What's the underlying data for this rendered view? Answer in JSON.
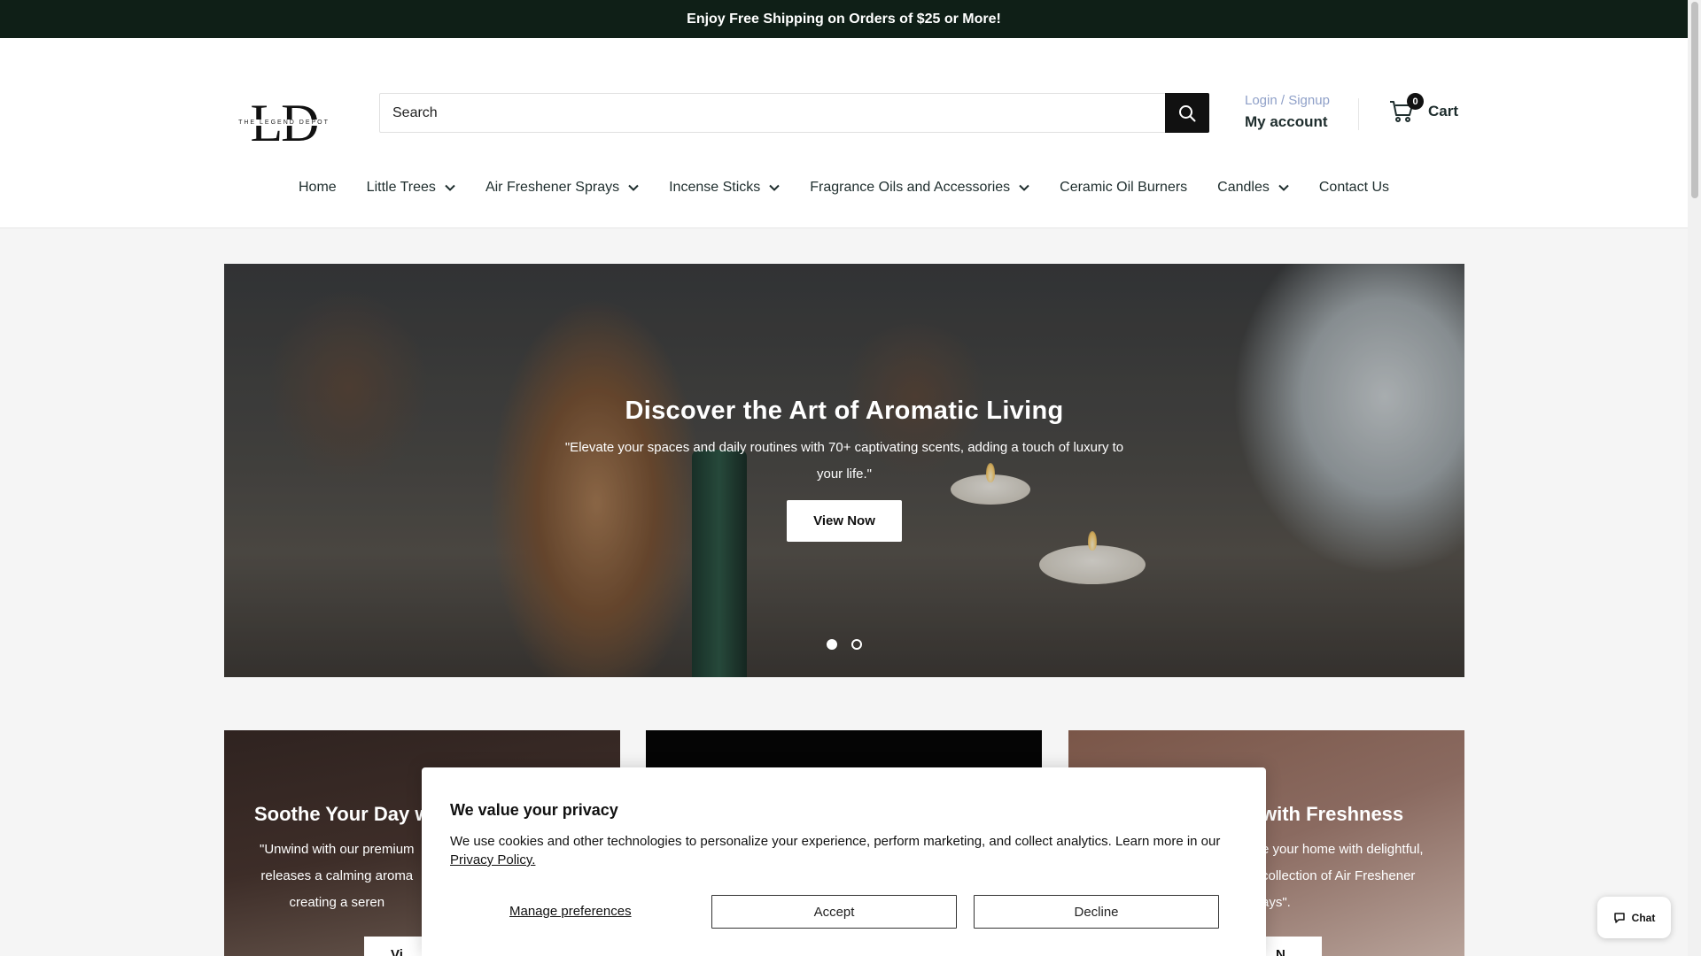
{
  "announcement": "Enjoy Free Shipping on Orders of $25 or More!",
  "header": {
    "logo_mark": "LD",
    "logo_text": "THE LEGEND DEPOT",
    "search_placeholder": "Search",
    "login_label": "Login / Signup",
    "account_label": "My account",
    "cart_count": "0",
    "cart_label": "Cart"
  },
  "nav": {
    "items": [
      {
        "label": "Home",
        "dropdown": false
      },
      {
        "label": "Little Trees",
        "dropdown": true
      },
      {
        "label": "Air Freshener Sprays",
        "dropdown": true
      },
      {
        "label": "Incense Sticks",
        "dropdown": true
      },
      {
        "label": "Fragrance Oils and Accessories",
        "dropdown": true
      },
      {
        "label": "Ceramic Oil Burners",
        "dropdown": false
      },
      {
        "label": "Candles",
        "dropdown": true
      },
      {
        "label": "Contact Us",
        "dropdown": false
      }
    ]
  },
  "hero": {
    "title": "Discover the Art of Aromatic Living",
    "subtitle": "\"Elevate your spaces and daily routines with 70+ captivating scents, adding a touch of luxury to your life.\"",
    "button_label": "View Now",
    "slide_count": 2,
    "active_slide": 1
  },
  "cards": [
    {
      "title": "Soothe Your Day wit",
      "lines": [
        "\"Unwind with our premium",
        "releases a calming aroma",
        "creating a seren"
      ],
      "button_label": "Vi"
    },
    {
      "title": "",
      "lines": [],
      "button_label": ""
    },
    {
      "title": "with Freshness",
      "lines": [
        "e your home with delightful,",
        "collection of Air Freshener",
        "ays\"."
      ],
      "button_label": "N"
    }
  ],
  "cookie": {
    "title": "We value your privacy",
    "text": "We use cookies and other technologies to personalize your experience, perform marketing, and collect analytics. Learn more in our",
    "link_label": "Privacy Policy.",
    "manage_label": "Manage preferences",
    "accept_label": "Accept",
    "decline_label": "Decline"
  },
  "chat": {
    "label": "Chat"
  },
  "colors": {
    "announcement_bg": "#0f1f17",
    "login_link": "#8fa0c8",
    "text": "#1e2d2d"
  }
}
